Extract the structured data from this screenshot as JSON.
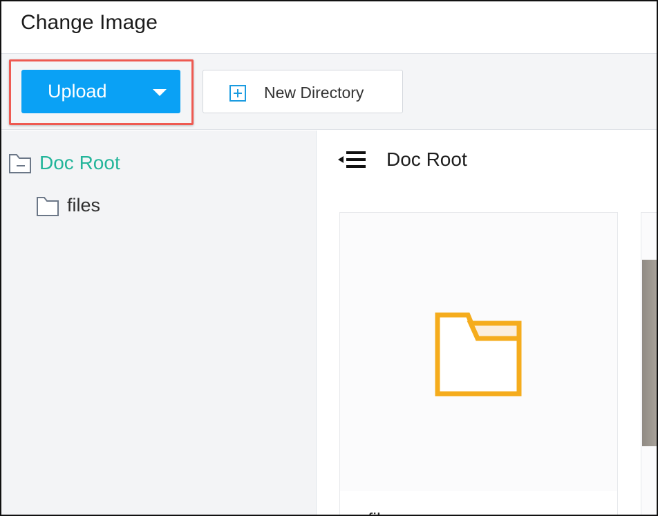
{
  "dialog": {
    "title": "Change Image"
  },
  "toolbar": {
    "upload_label": "Upload",
    "new_directory_label": "New Directory"
  },
  "tree": {
    "root_label": "Doc Root",
    "children": [
      {
        "label": "files"
      }
    ]
  },
  "main": {
    "breadcrumb": "Doc Root",
    "items": [
      {
        "label": "files",
        "icon": "folder-icon",
        "type": "folder"
      }
    ]
  },
  "colors": {
    "primary": "#0aa1f5",
    "highlight": "#ee5a52",
    "active_tree": "#23b59a",
    "folder": "#f5ac1d"
  }
}
